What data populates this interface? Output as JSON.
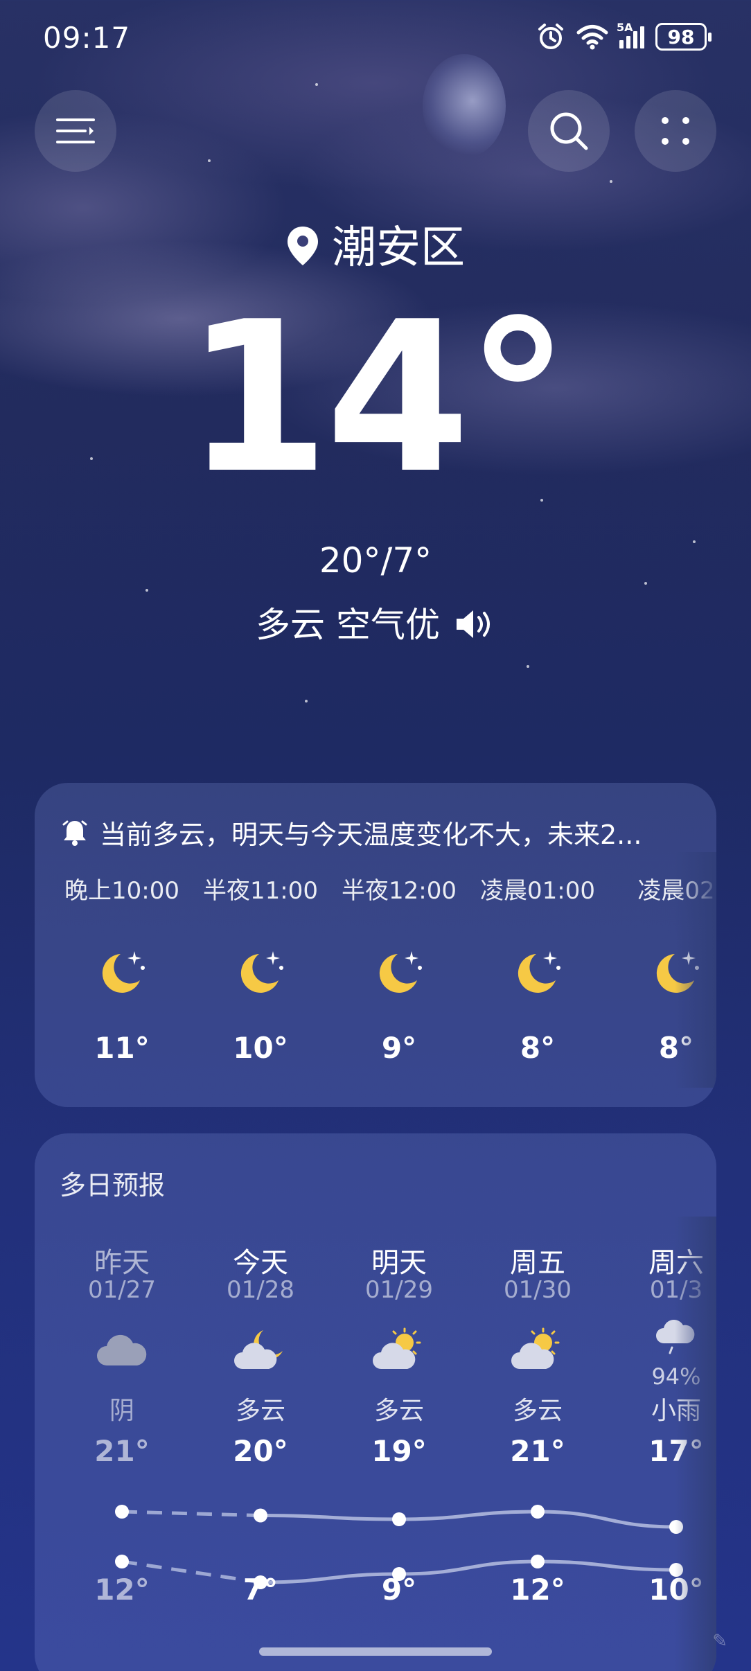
{
  "status_bar": {
    "time": "09:17",
    "network": "5A",
    "battery": "98"
  },
  "location": "潮安区",
  "current": {
    "temperature": "14°",
    "high_low": "20°/7°",
    "condition": "多云 空气优"
  },
  "hourly": {
    "alert": "当前多云，明天与今天温度变化不大，未来2...",
    "items": [
      {
        "time": "晚上10:00",
        "icon": "moon-stars-icon",
        "temp": "11°"
      },
      {
        "time": "半夜11:00",
        "icon": "moon-stars-icon",
        "temp": "10°"
      },
      {
        "time": "半夜12:00",
        "icon": "moon-stars-icon",
        "temp": "9°"
      },
      {
        "time": "凌晨01:00",
        "icon": "moon-stars-icon",
        "temp": "8°"
      },
      {
        "time": "凌晨02",
        "icon": "moon-stars-icon",
        "temp": "8°"
      }
    ]
  },
  "daily": {
    "title": "多日预报",
    "items": [
      {
        "day": "昨天",
        "date": "01/27",
        "icon": "cloud-icon",
        "condition": "阴",
        "high": "21°",
        "low": "12°",
        "high_value": 21,
        "low_value": 12,
        "past": true
      },
      {
        "day": "今天",
        "date": "01/28",
        "icon": "cloudy-night-icon",
        "condition": "多云",
        "high": "20°",
        "low": "7°",
        "high_value": 20,
        "low_value": 7,
        "past": false
      },
      {
        "day": "明天",
        "date": "01/29",
        "icon": "partly-cloudy-icon",
        "condition": "多云",
        "high": "19°",
        "low": "9°",
        "high_value": 19,
        "low_value": 9,
        "past": false
      },
      {
        "day": "周五",
        "date": "01/30",
        "icon": "partly-cloudy-icon",
        "condition": "多云",
        "high": "21°",
        "low": "12°",
        "high_value": 21,
        "low_value": 12,
        "past": false
      },
      {
        "day": "周六",
        "date": "01/3",
        "icon": "light-rain-icon",
        "precip": "94%",
        "condition": "小雨",
        "high": "17°",
        "low": "10°",
        "high_value": 17,
        "low_value": 10,
        "past": false
      }
    ]
  },
  "colors": {
    "moon": "#f6c945",
    "sun": "#f6c945",
    "cloud": "#d6d9e8",
    "dark_cloud": "#9aa0b8"
  }
}
